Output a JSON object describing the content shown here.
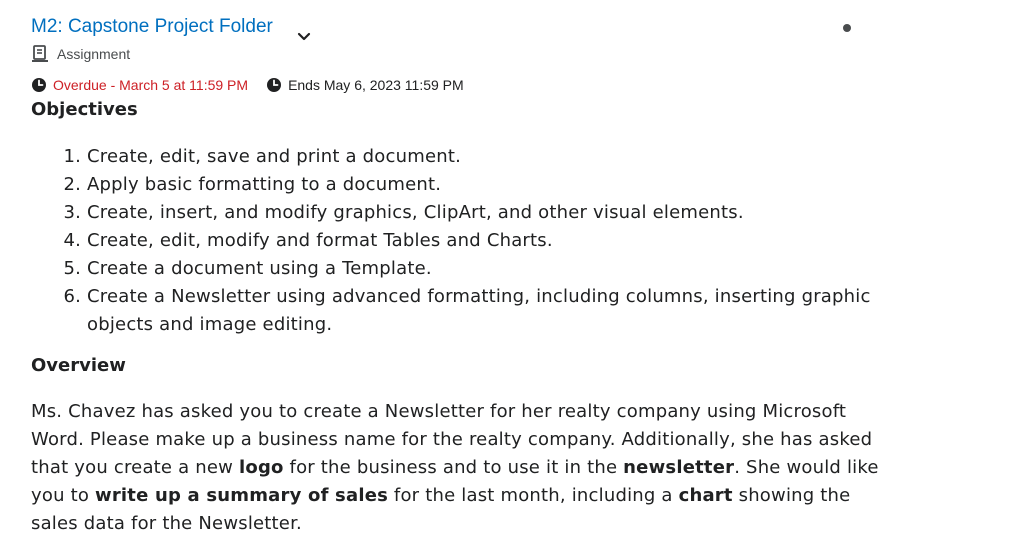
{
  "header": {
    "title": "M2: Capstone Project Folder",
    "type_label": "Assignment",
    "overdue_text": "Overdue - March 5 at 11:59 PM",
    "ends_text": "Ends May 6, 2023 11:59 PM"
  },
  "colors": {
    "link": "#006fbf",
    "overdue": "#cd2026",
    "text": "#202122",
    "muted": "#494c4e"
  },
  "icons": {
    "expand": "chevron-down-icon",
    "type": "assignment-icon",
    "clock": "clock-icon"
  },
  "objectives": {
    "heading": "Objectives",
    "items": [
      "Create, edit, save and print a document.",
      "Apply basic formatting to a document.",
      "Create, insert, and modify graphics, ClipArt, and other visual elements.",
      "Create, edit, modify and format Tables and Charts.",
      "Create a document using a Template.",
      "Create a Newsletter using advanced formatting, including columns, inserting graphic objects and image editing."
    ]
  },
  "overview": {
    "heading": "Overview",
    "p1": "Ms. Chavez has asked you to create a Newsletter for her realty company using Microsoft Word. Please make up a business name for the realty company. Additionally, she has asked that you create a new ",
    "b1": "logo",
    "p2": " for the business and to use it in the ",
    "b2": "newsletter",
    "p3": ". She would like you to ",
    "b3": "write up a summary of sales",
    "p4": " for the last month, including a ",
    "b4": "chart",
    "p5": " showing the sales data for the Newsletter."
  }
}
